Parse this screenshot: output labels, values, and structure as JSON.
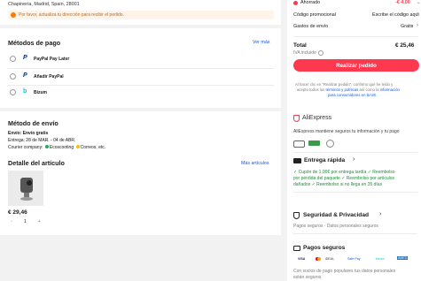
{
  "address": {
    "line": "Chapinería, Madrid, Spain, 28001",
    "warning": "Por favor, actualiza tu dirección para recibir el pedido."
  },
  "payment": {
    "title": "Métodos de pago",
    "more": "Ver más",
    "methods": [
      {
        "label": "PayPal Pay Later"
      },
      {
        "label": "Añadir PayPal"
      },
      {
        "label": "Bizum"
      }
    ]
  },
  "shipping": {
    "title": "Método de envío",
    "line1": "Envío: Envío gratis",
    "line2": "Entrega: 28 de MAR. - 04 de ABR.",
    "courier_prefix": "Courier company:",
    "courier_a": "Ecoscooting",
    "courier_b": "Correos",
    "courier_suffix": ", etc."
  },
  "item": {
    "title": "Detalle del artículo",
    "more": "Más artículos",
    "price": "€ 29,46",
    "qty_minus": "-",
    "qty": "1",
    "qty_plus": "+"
  },
  "summary": {
    "saved_label": "Ahorrado",
    "saved_value": "-€ 4,00",
    "promo_label": "Código promocional",
    "promo_value": "Escribe el código aqui",
    "shipping_label": "Gastos de envío",
    "shipping_value": "Gratis",
    "total_label": "Total",
    "total_value": "€ 25,46",
    "iva": "IVA incluido",
    "order_button": "Realizar pedido",
    "legal_1": "Al hacer clic en \"Realizar pedido\", confirmo que he leído y",
    "legal_2a": "acepto todos los",
    "legal_terms": "términos y políticas",
    "legal_2b": "así como la",
    "legal_info": "información",
    "legal_3": "para consumidores en la UE."
  },
  "aliexpress": {
    "brand": "AliExpress",
    "tagline": "AliExpress mantiene seguros tu información y tu pago"
  },
  "delivery": {
    "title": "Entrega rápida",
    "line1a": "Cupón de 1,00€ por entrega tardía",
    "line1b": "Reembolso",
    "line2a": "por pérdida del paquete",
    "line2b": "Reembolso por artículos",
    "line3a": "dañados",
    "line3b": "Reembolso si no llega en 35 días"
  },
  "security": {
    "title": "Seguridad & Privacidad",
    "line": "Pagos seguros · Datos personales seguros"
  },
  "secure_payments": {
    "title": "Pagos seguros",
    "logos": [
      "VISA",
      "mastercard",
      "iDEAL",
      "Safe Pay",
      "bizum",
      "AMEX"
    ],
    "line1": "Con socios de pago populares tus datos personales",
    "line2": "están seguros"
  },
  "colors": {
    "accent": "#fd384f",
    "link": "#1a56db",
    "green": "#1a8e3a"
  }
}
